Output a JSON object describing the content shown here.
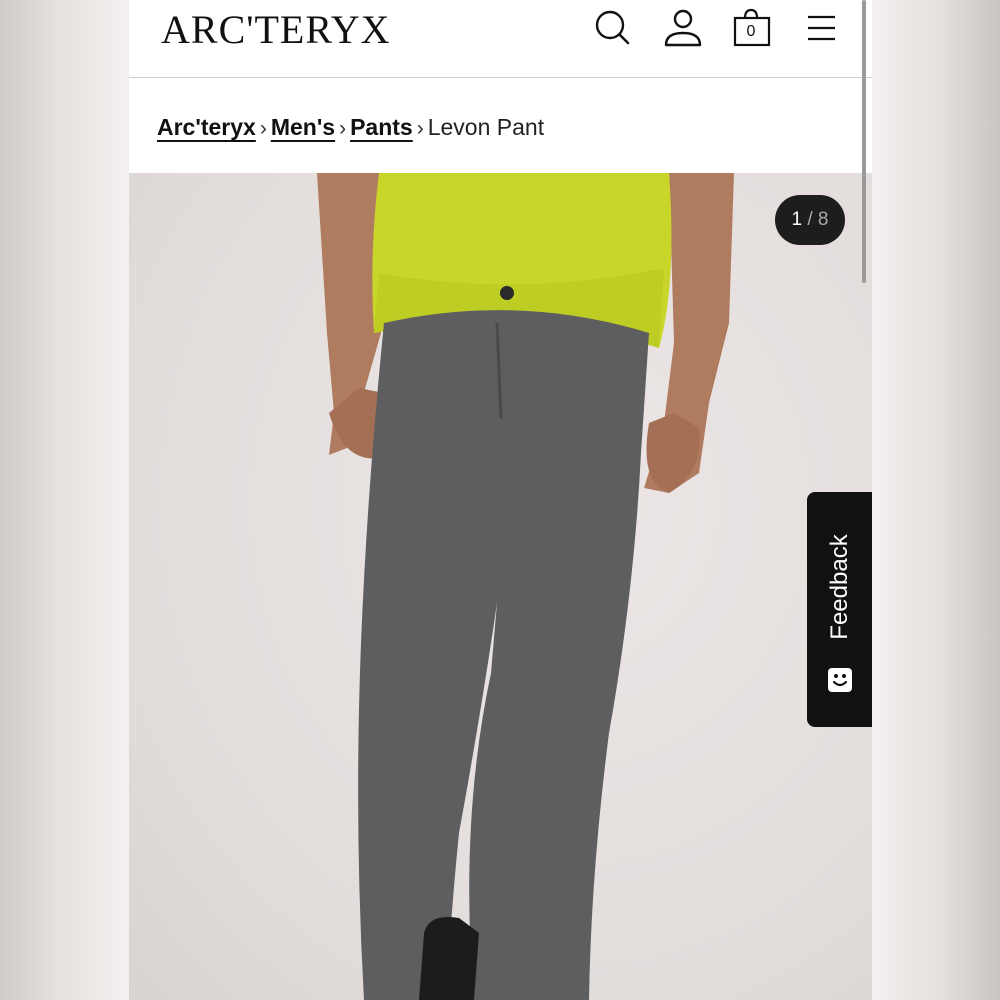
{
  "header": {
    "logo_text": "ARC'TERYX",
    "search_icon": "search-icon",
    "account_icon": "user-icon",
    "cart_icon": "shopping-bag-icon",
    "cart_count": "0",
    "menu_icon": "hamburger-menu-icon"
  },
  "breadcrumb": {
    "items": [
      {
        "label": "Arc'teryx",
        "link": true
      },
      {
        "label": "Men's",
        "link": true
      },
      {
        "label": "Pants",
        "link": true
      },
      {
        "label": "Levon Pant",
        "link": false
      }
    ],
    "separator": "›"
  },
  "gallery": {
    "current": "1",
    "separator": "/",
    "total": "8",
    "image_description": "product-photo"
  },
  "feedback_tab": {
    "label": "Feedback",
    "icon": "smiley-icon"
  },
  "colors": {
    "accent": "#111111",
    "shirt": "#c8d62a",
    "pants": "#5e5e60"
  }
}
